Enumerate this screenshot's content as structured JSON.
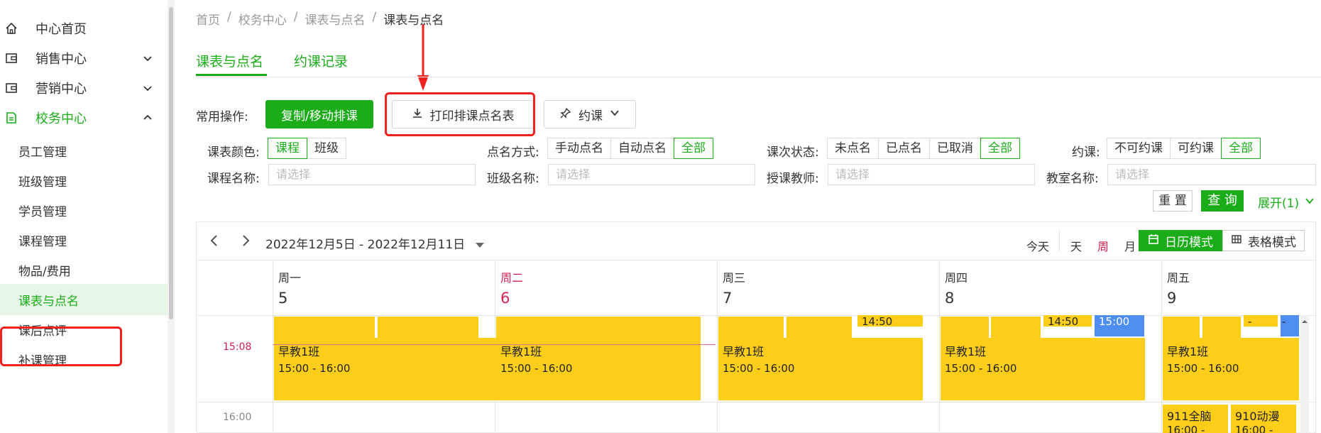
{
  "sidebar": {
    "top_items": [
      {
        "label": "中心首页",
        "icon": "home-icon",
        "has_chevron": false
      },
      {
        "label": "销售中心",
        "icon": "wallet-icon",
        "has_chevron": true,
        "chevron": "down"
      },
      {
        "label": "营销中心",
        "icon": "wallet-icon",
        "has_chevron": true,
        "chevron": "down"
      },
      {
        "label": "校务中心",
        "icon": "document-icon",
        "has_chevron": true,
        "chevron": "up",
        "active": true
      }
    ],
    "sub_items": [
      "员工管理",
      "班级管理",
      "学员管理",
      "课程管理",
      "物品/费用",
      "课表与点名",
      "课后点评",
      "补课管理"
    ],
    "active_sub": "课表与点名"
  },
  "breadcrumb": [
    "首页",
    "/",
    "校务中心",
    "/",
    "课表与点名",
    "/",
    "课表与点名"
  ],
  "tabs": [
    "课表与点名",
    "约课记录"
  ],
  "operations": {
    "label": "常用操作:",
    "copy_button": "复制/移动排课",
    "print_button": "打印排课点名表",
    "yueke_button": "约课"
  },
  "filters": {
    "color": {
      "label": "课表颜色:",
      "options": [
        "课程",
        "班级"
      ],
      "selected": "课程"
    },
    "rollcall": {
      "label": "点名方式:",
      "options": [
        "手动点名",
        "自动点名",
        "全部"
      ],
      "selected": "全部"
    },
    "status": {
      "label": "课次状态:",
      "options": [
        "未点名",
        "已点名",
        "已取消",
        "全部"
      ],
      "selected": "全部"
    },
    "booking": {
      "label": "约课:",
      "options": [
        "不可约课",
        "可约课",
        "全部"
      ],
      "selected": "全部"
    },
    "course_name": {
      "label": "课程名称:",
      "placeholder": "请选择"
    },
    "class_name": {
      "label": "班级名称:",
      "placeholder": "请选择"
    },
    "teacher": {
      "label": "授课教师:",
      "placeholder": "请选择"
    },
    "classroom": {
      "label": "教室名称:",
      "placeholder": "请选择"
    },
    "reset": "重 置",
    "query": "查 询",
    "expand": "展开(1)"
  },
  "calendar": {
    "range": "2022年12月5日 - 2022年12月11日",
    "views": [
      "今天",
      "天",
      "周",
      "月"
    ],
    "active_view": "周",
    "mode_calendar": "日历模式",
    "mode_table": "表格模式",
    "days": [
      {
        "name": "周一",
        "date": "5"
      },
      {
        "name": "周二",
        "date": "6",
        "today": true
      },
      {
        "name": "周三",
        "date": "7"
      },
      {
        "name": "周四",
        "date": "8"
      },
      {
        "name": "周五",
        "date": "9"
      }
    ],
    "times": [
      "15:08",
      "16:00"
    ],
    "partial_times": [
      "14:50",
      "14:50",
      "15:00",
      "-",
      "-",
      "15"
    ],
    "event_title": "早教1班",
    "event_time": "15:00 - 16:00",
    "lower_events": [
      {
        "title": "911全脑",
        "time": "16:00 -"
      },
      {
        "title": "910动漫",
        "time": "16:00 -"
      }
    ],
    "colors": {
      "event": "#fcce1a",
      "blue_event": "#4d8ef0",
      "accent": "#1aad19",
      "today": "#d6204f",
      "highlight": "#f0221f"
    }
  }
}
